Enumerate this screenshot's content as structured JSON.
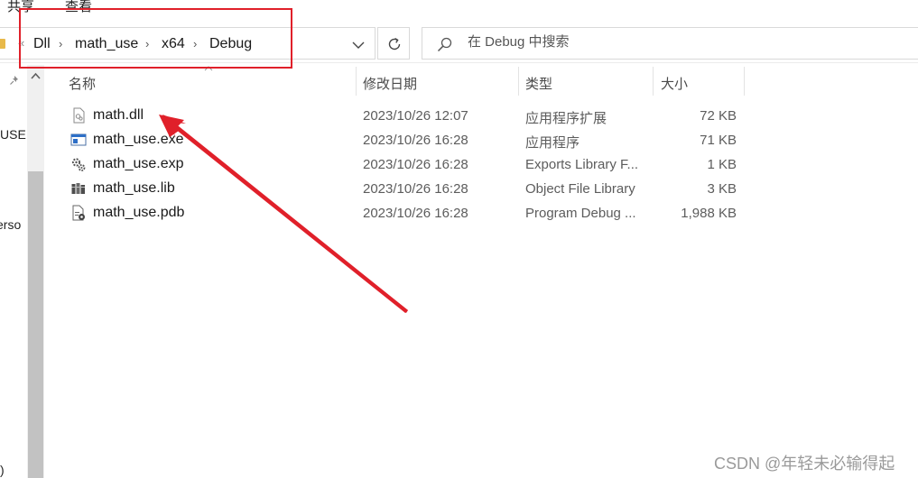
{
  "ribbon": {
    "tabs": [
      "共享",
      "查看"
    ]
  },
  "address": {
    "crumbs": [
      "Dll",
      "math_use",
      "x64",
      "Debug"
    ]
  },
  "search": {
    "placeholder": "在 Debug 中搜索"
  },
  "left_pane": {
    "labels": [
      "USE",
      "erso",
      ")"
    ]
  },
  "columns": {
    "name": "名称",
    "date": "修改日期",
    "type": "类型",
    "size": "大小"
  },
  "files": [
    {
      "name": "math.dll",
      "date": "2023/10/26 12:07",
      "type": "应用程序扩展",
      "size": "72 KB",
      "icon": "dll-file-icon"
    },
    {
      "name": "math_use.exe",
      "date": "2023/10/26 16:28",
      "type": "应用程序",
      "size": "71 KB",
      "icon": "exe-file-icon"
    },
    {
      "name": "math_use.exp",
      "date": "2023/10/26 16:28",
      "type": "Exports Library F...",
      "size": "1 KB",
      "icon": "exp-file-icon"
    },
    {
      "name": "math_use.lib",
      "date": "2023/10/26 16:28",
      "type": "Object File Library",
      "size": "3 KB",
      "icon": "lib-file-icon"
    },
    {
      "name": "math_use.pdb",
      "date": "2023/10/26 16:28",
      "type": "Program Debug ...",
      "size": "1,988 KB",
      "icon": "pdb-file-icon"
    }
  ],
  "watermark": "CSDN @年轻未必输得起",
  "annotation_color": "#e0202a"
}
